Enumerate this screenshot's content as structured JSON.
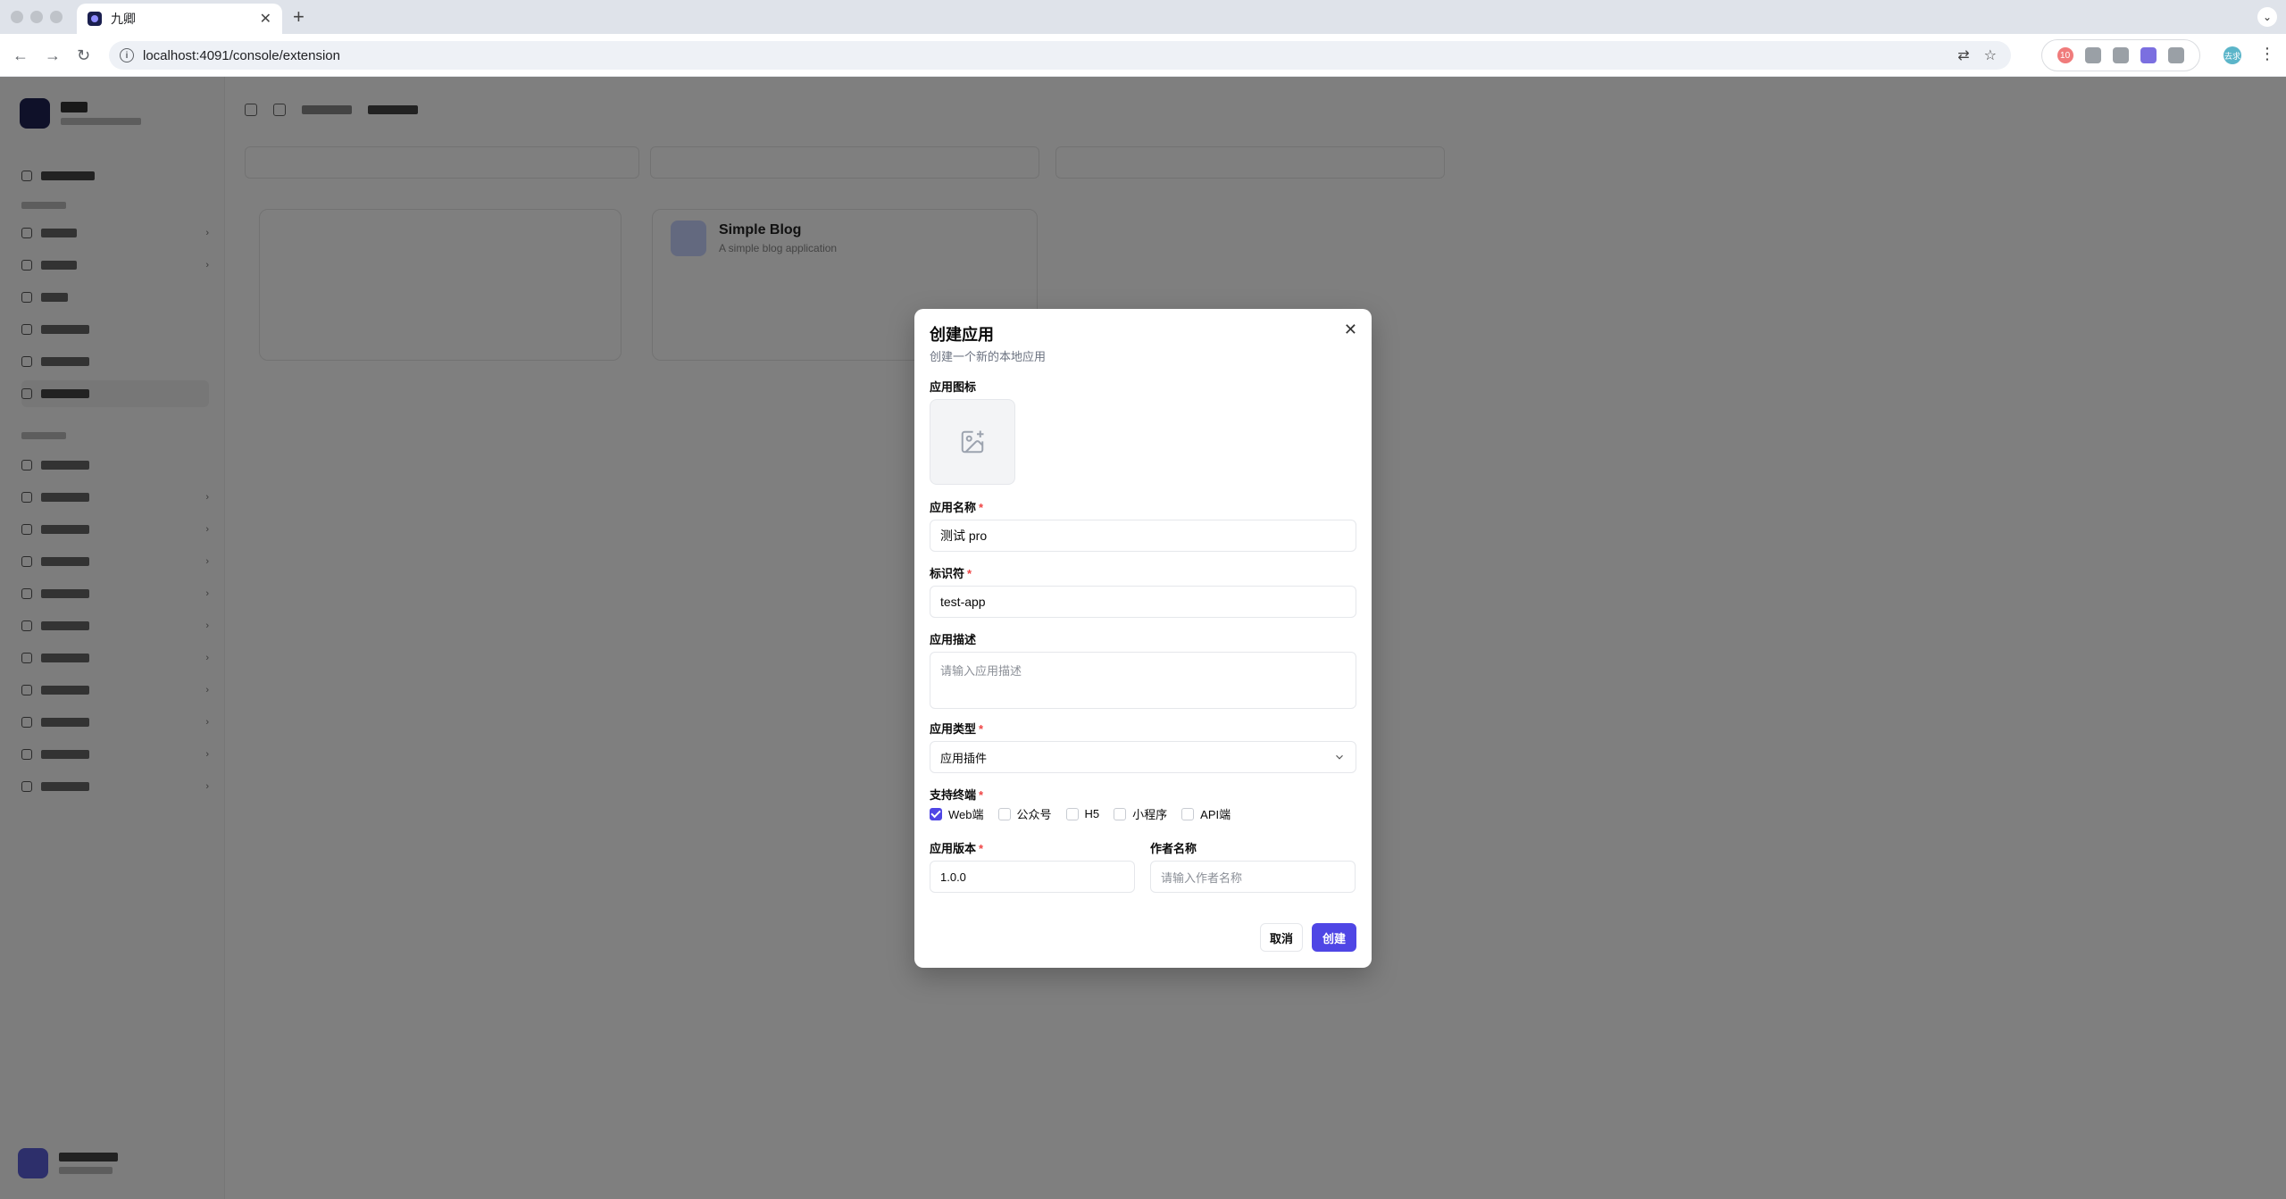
{
  "browser": {
    "tab_title": "九卿",
    "url": "localhost:4091/console/extension",
    "profile_initial": "去求",
    "ext_badge": "10"
  },
  "dialog": {
    "title": "创建应用",
    "description": "创建一个新的本地应用",
    "icon_label": "应用图标",
    "name_label": "应用名称",
    "name_value": "测试 pro",
    "identifier_label": "标识符",
    "identifier_value": "test-app",
    "desc_label": "应用描述",
    "desc_placeholder": "请输入应用描述",
    "type_label": "应用类型",
    "type_value": "应用插件",
    "terminals_label": "支持终端",
    "terminals": [
      {
        "label": "Web端",
        "checked": true
      },
      {
        "label": "公众号",
        "checked": false
      },
      {
        "label": "H5",
        "checked": false
      },
      {
        "label": "小程序",
        "checked": false
      },
      {
        "label": "API端",
        "checked": false
      }
    ],
    "version_label": "应用版本",
    "version_value": "1.0.0",
    "author_label": "作者名称",
    "author_placeholder": "请输入作者名称",
    "cancel_label": "取消",
    "create_label": "创建",
    "required_mark": "*"
  },
  "background": {
    "card_title": "Simple Blog",
    "card_sub": "A simple blog application"
  }
}
